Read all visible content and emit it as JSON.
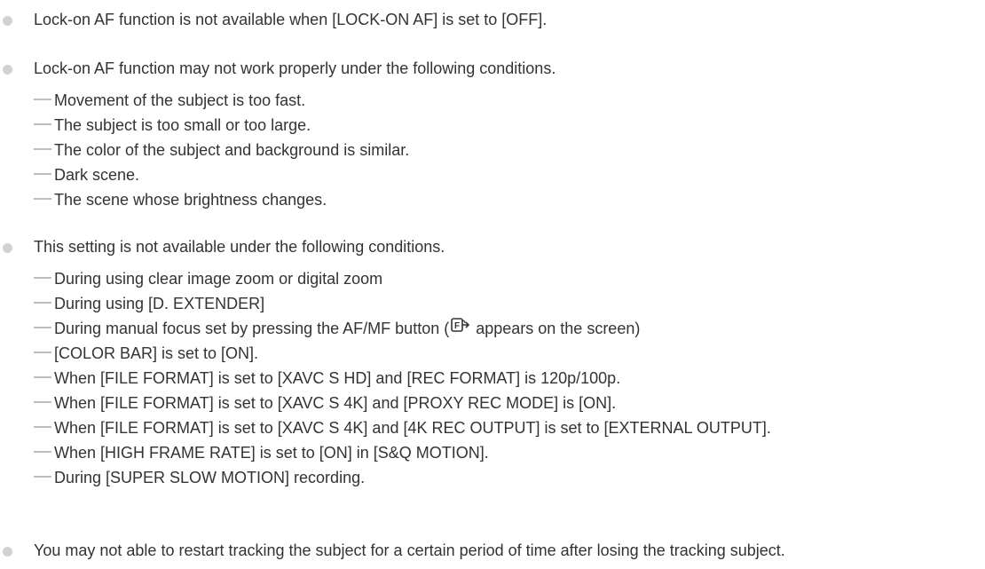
{
  "notes": [
    {
      "text": "Lock-on AF function is not available when [LOCK-ON AF] is set to [OFF].",
      "items": []
    },
    {
      "text": "Lock-on AF function may not work properly under the following conditions.",
      "items": [
        "Movement of the subject is too fast.",
        "The subject is too small or too large.",
        "The color of the subject and background is similar.",
        "Dark scene.",
        "The scene whose brightness changes."
      ]
    },
    {
      "text": "This setting is not available under the following conditions.",
      "items": [
        "During using clear image zoom or digital zoom",
        "During using [D. EXTENDER]",
        "During manual focus set by pressing the AF/MF button (",
        "[COLOR BAR] is set to [ON].",
        "When [FILE FORMAT] is set to [XAVC S HD] and [REC FORMAT] is 120p/100p.",
        "When [FILE FORMAT] is set to [XAVC S 4K] and [PROXY REC MODE] is [ON].",
        "When [FILE FORMAT] is set to [XAVC S 4K] and [4K REC OUTPUT] is set to [EXTERNAL OUTPUT].",
        "When [HIGH FRAME RATE] is set to [ON] in [S&Q MOTION].",
        "During [SUPER SLOW MOTION] recording."
      ],
      "item2_suffix": "appears on the screen)",
      "item2_icon": "manual-focus-icon"
    },
    {
      "text": "You may not able to restart tracking the subject for a certain period of time after losing the tracking subject.",
      "items": []
    }
  ]
}
